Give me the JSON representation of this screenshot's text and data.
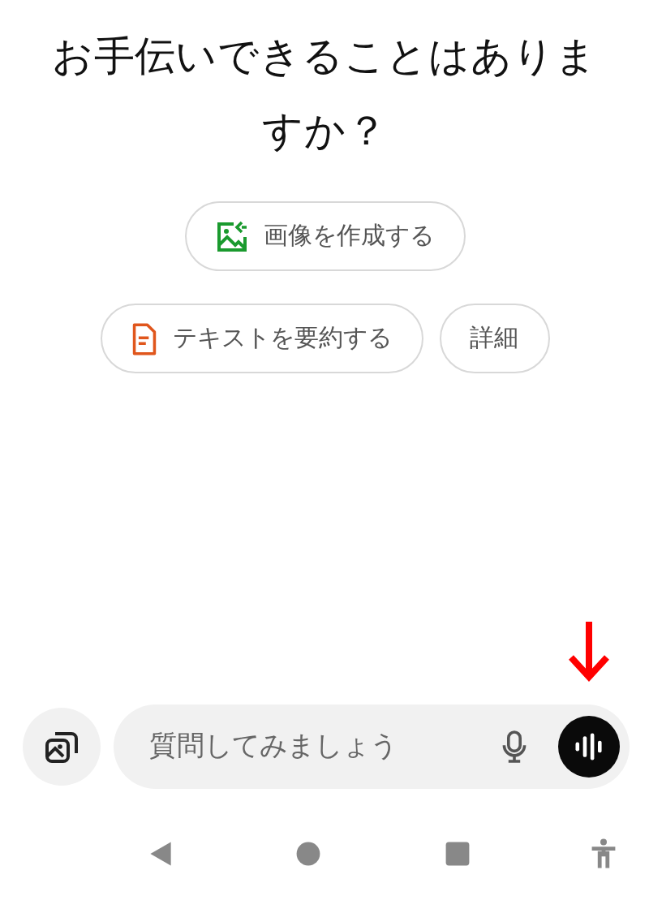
{
  "heading": "お手伝いできることはありますか？",
  "suggestions": [
    [
      {
        "kind": "image",
        "label": "画像を作成する"
      }
    ],
    [
      {
        "kind": "document",
        "label": "テキストを要約する"
      },
      {
        "kind": "plain",
        "label": "詳細"
      }
    ]
  ],
  "prompt": {
    "placeholder": "質問してみましょう"
  }
}
